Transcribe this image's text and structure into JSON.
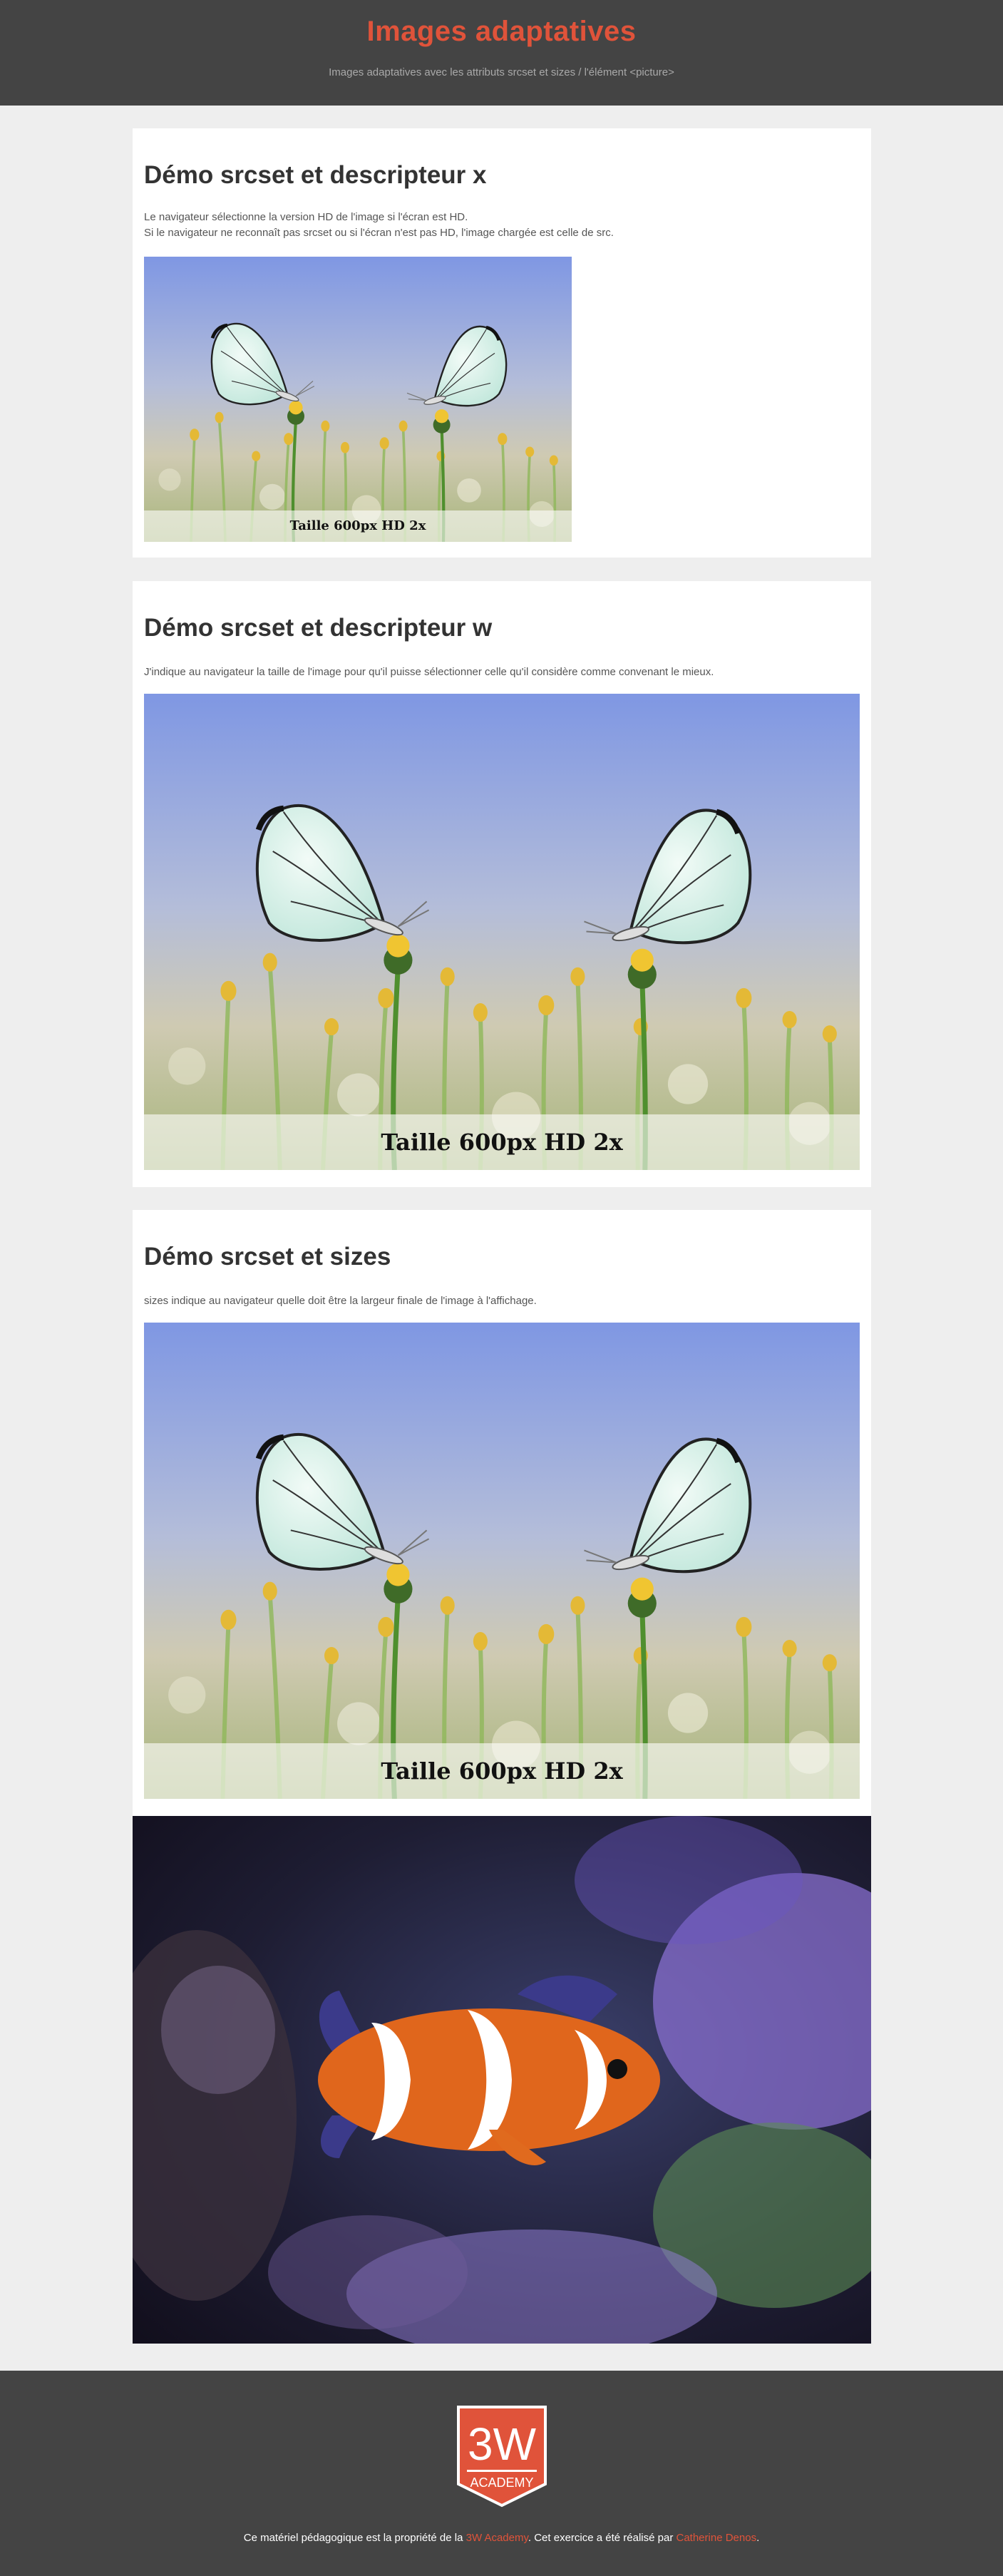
{
  "header": {
    "title": "Images adaptatives",
    "subtitle": "Images adaptatives avec les attributs srcset et sizes / l'élément <picture>"
  },
  "sections": [
    {
      "title": "Démo srcset et descripteur x",
      "lines": [
        "Le navigateur sélectionne la version HD de l'image si l'écran est HD.",
        "Si le navigateur ne reconnaît pas srcset ou si l'écran n'est pas HD, l'image chargée est celle de src."
      ],
      "caption": "Taille 600px HD 2x"
    },
    {
      "title": "Démo srcset et descripteur w",
      "lines": [
        "J'indique au navigateur la taille de l'image pour qu'il puisse sélectionner celle qu'il considère comme convenant le mieux."
      ],
      "caption": "Taille 600px HD 2x"
    },
    {
      "title": "Démo srcset et sizes",
      "lines": [
        "sizes indique au navigateur quelle doit être la largeur finale de l'image à l'affichage."
      ],
      "caption": "Taille 600px HD 2x"
    }
  ],
  "footer": {
    "logo_main": "3W",
    "logo_sub": "ACADEMY",
    "text_before": "Ce matériel pédagogique est la propriété de la ",
    "link_1": "3W Academy",
    "text_middle": ". Cet exercice a été réalisé par ",
    "link_2": "Catherine Denos",
    "text_after": "."
  },
  "colors": {
    "accent": "#e0533a",
    "header_bg": "#444444",
    "page_bg": "#eeeeee"
  }
}
